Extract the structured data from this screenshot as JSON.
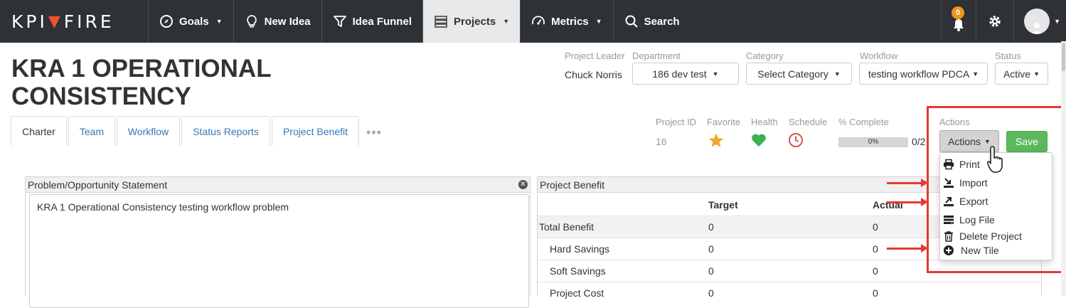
{
  "nav": {
    "brand": [
      "KPI",
      "FIRE"
    ],
    "items": [
      {
        "label": "Goals",
        "has_caret": true
      },
      {
        "label": "New Idea",
        "has_caret": false
      },
      {
        "label": "Idea Funnel",
        "has_caret": false
      },
      {
        "label": "Projects",
        "has_caret": true
      },
      {
        "label": "Metrics",
        "has_caret": true
      },
      {
        "label": "Search",
        "has_caret": false
      }
    ],
    "notification_count": "0",
    "colors": {
      "bar": "#2e3135",
      "accent": "#f0522b",
      "badge": "#f0961c"
    }
  },
  "project": {
    "title": "KRA 1 OPERATIONAL CONSISTENCY",
    "leader_label": "Project Leader",
    "leader_value": "Chuck Norris",
    "department_label": "Department",
    "department_value": "186 dev test",
    "category_label": "Category",
    "category_value": "Select Category",
    "workflow_label": "Workflow",
    "workflow_value": "testing workflow PDCA",
    "status_label": "Status",
    "status_value": "Active"
  },
  "tabs": [
    "Charter",
    "Team",
    "Workflow",
    "Status Reports",
    "Project Benefit"
  ],
  "stats": {
    "project_id_label": "Project ID",
    "project_id": "16",
    "favorite_label": "Favorite",
    "health_label": "Health",
    "schedule_label": "Schedule",
    "complete_label": "% Complete",
    "complete_value": "0%",
    "complete_fraction": "0/2",
    "actions_label": "Actions"
  },
  "buttons": {
    "actions": "Actions",
    "save": "Save"
  },
  "actions_menu": [
    {
      "label": "Print",
      "icon": "print-icon"
    },
    {
      "label": "Import",
      "icon": "import-icon"
    },
    {
      "label": "Export",
      "icon": "export-icon"
    },
    {
      "label": "Log File",
      "icon": "log-file-icon"
    },
    {
      "label": "Delete Project",
      "icon": "trash-icon"
    },
    {
      "label": "New Tile",
      "icon": "plus-circle-icon"
    }
  ],
  "problem_panel": {
    "title": "Problem/Opportunity Statement",
    "text": "KRA 1 Operational Consistency testing workflow problem"
  },
  "benefit_panel": {
    "title": "Project Benefit",
    "columns": [
      "Target",
      "Actual"
    ],
    "rows": [
      {
        "label": "Total Benefit",
        "target": "0",
        "actual": "0"
      },
      {
        "label": "Hard Savings",
        "target": "0",
        "actual": "0"
      },
      {
        "label": "Soft Savings",
        "target": "0",
        "actual": "0"
      },
      {
        "label": "Project Cost",
        "target": "0",
        "actual": "0"
      }
    ]
  }
}
